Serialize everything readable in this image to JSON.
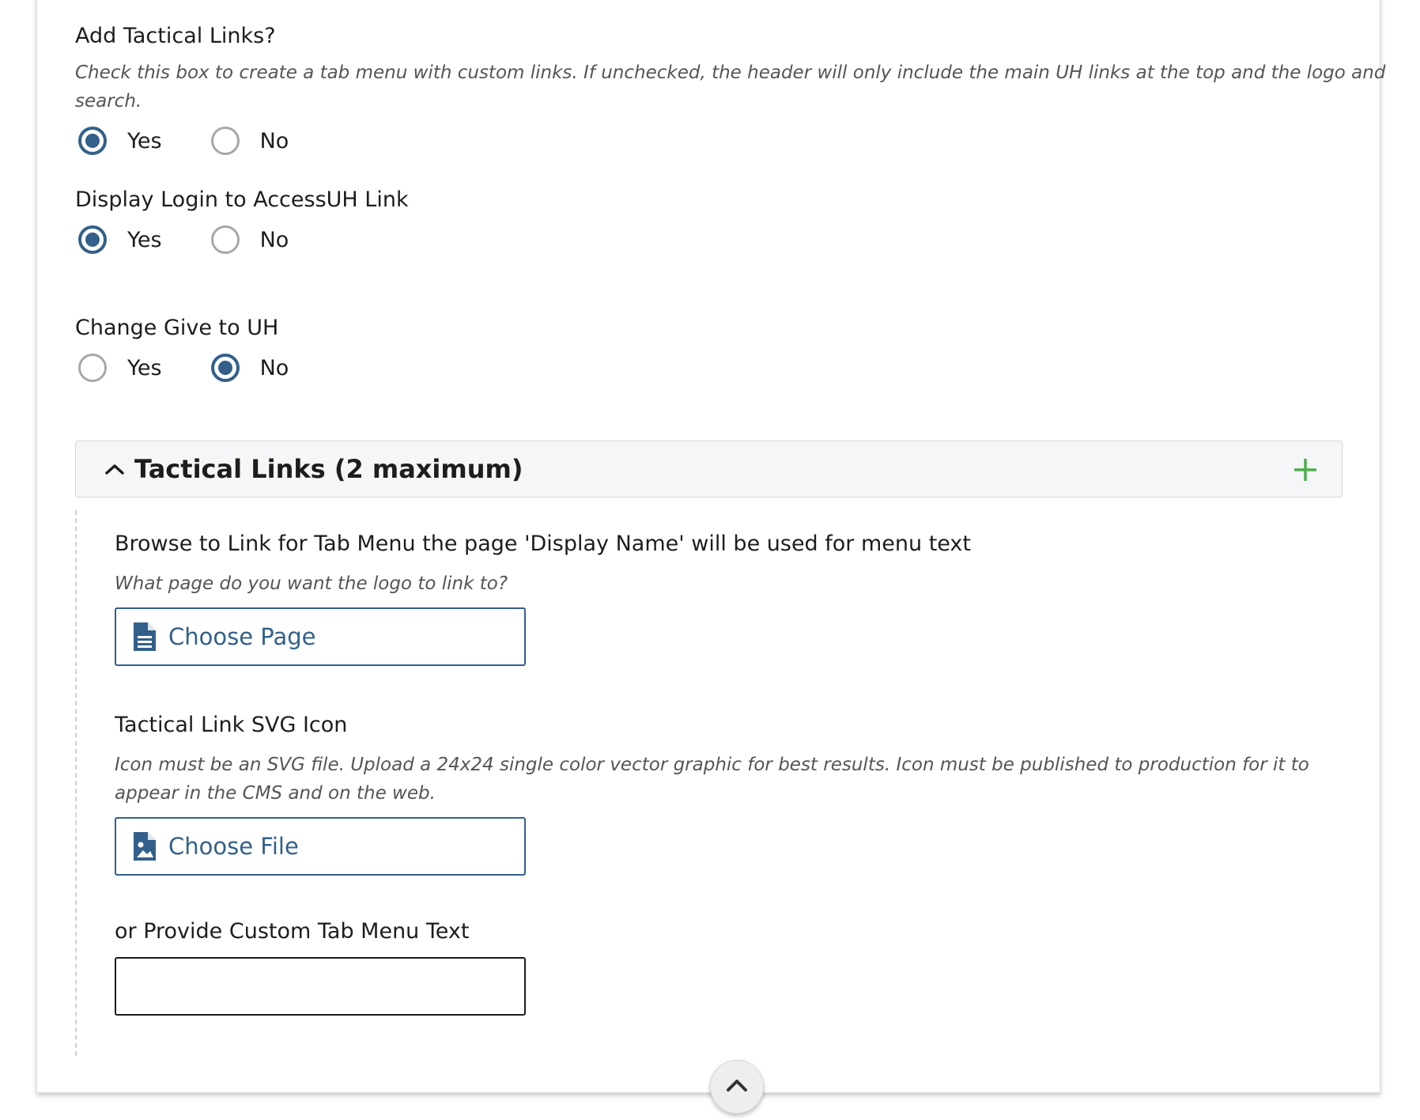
{
  "fields": {
    "tactical_links": {
      "label": "Add Tactical Links?",
      "help": "Check this box to create a tab menu with custom links. If unchecked, the header will only include the main UH links at the top and the logo and search.",
      "options": [
        "Yes",
        "No"
      ],
      "selected": "Yes"
    },
    "login_link": {
      "label": "Display Login to AccessUH Link",
      "options": [
        "Yes",
        "No"
      ],
      "selected": "Yes"
    },
    "give_to_uh": {
      "label": "Change Give to UH",
      "options": [
        "Yes",
        "No"
      ],
      "selected": "No"
    }
  },
  "section": {
    "title": "Tactical Links (2 maximum)",
    "browse": {
      "label": "Browse to Link for Tab Menu the page 'Display Name' will be used for menu text",
      "help": "What page do you want the logo to link to?",
      "button_label": "Choose Page",
      "icon": "document-icon"
    },
    "svg_icon": {
      "label": "Tactical Link SVG Icon",
      "help": "Icon must be an SVG file. Upload a 24x24 single color vector graphic for best results. Icon must be published to production for it to appear in the CMS and on the web.",
      "button_label": "Choose File",
      "icon": "image-file-icon"
    },
    "custom_text": {
      "label": "or Provide Custom Tab Menu Text",
      "value": "",
      "placeholder": ""
    }
  },
  "colors": {
    "accent": "#33608a",
    "add_green": "#4cae4c",
    "radio_off": "#a7a7a7"
  }
}
